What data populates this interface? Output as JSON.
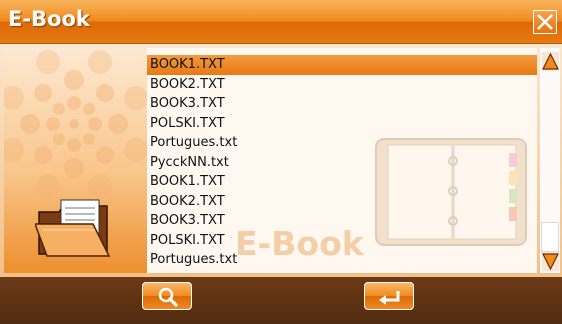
{
  "window": {
    "title": "E-Book"
  },
  "file_list": {
    "items": [
      {
        "name": "BOOK1.TXT",
        "selected": true
      },
      {
        "name": "BOOK2.TXT",
        "selected": false
      },
      {
        "name": "BOOK3.TXT",
        "selected": false
      },
      {
        "name": "POLSKI.TXT",
        "selected": false
      },
      {
        "name": "Portugues.txt",
        "selected": false
      },
      {
        "name": "PycckNN.txt",
        "selected": false
      },
      {
        "name": "BOOK1.TXT",
        "selected": false
      },
      {
        "name": "BOOK2.TXT",
        "selected": false
      },
      {
        "name": "BOOK3.TXT",
        "selected": false
      },
      {
        "name": "POLSKI.TXT",
        "selected": false
      },
      {
        "name": "Portugues.txt",
        "selected": false
      }
    ],
    "watermark": "E-Book"
  },
  "icons": {
    "close": "close-icon",
    "folder": "open-folder-icon",
    "binder": "binder-icon",
    "scroll_up": "arrow-up-icon",
    "scroll_down": "arrow-down-icon",
    "search": "magnifier-icon",
    "enter": "enter-arrow-icon"
  },
  "colors": {
    "accent": "#f08a1e",
    "selection": "#ee8a2a",
    "footer": "#5a2f12"
  }
}
